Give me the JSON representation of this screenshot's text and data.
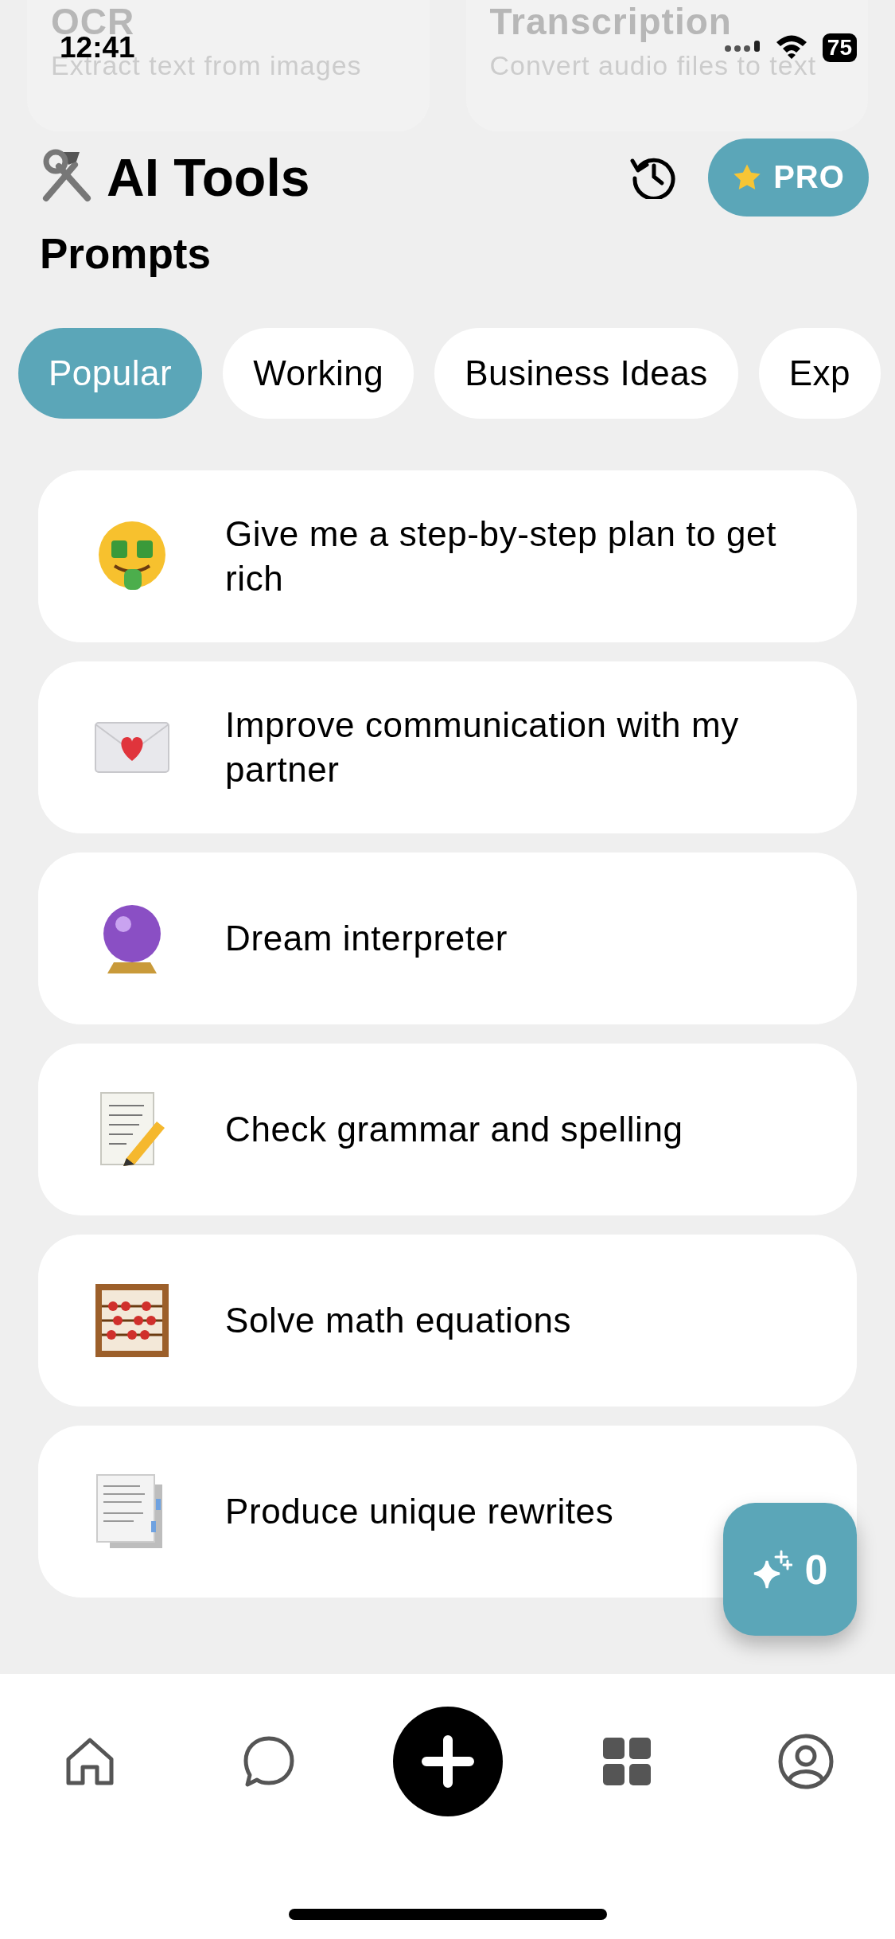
{
  "status_bar": {
    "time": "12:41",
    "battery": "75"
  },
  "background_cards": [
    {
      "title": "OCR",
      "subtitle": "Extract text from images"
    },
    {
      "title": "Transcription",
      "subtitle": "Convert audio files to text"
    }
  ],
  "header": {
    "title": "AI Tools",
    "pro_button": "PRO"
  },
  "section_title": "Prompts",
  "categories": [
    {
      "label": "Popular",
      "selected": true
    },
    {
      "label": "Working",
      "selected": false
    },
    {
      "label": "Business Ideas",
      "selected": false
    },
    {
      "label": "Exp",
      "selected": false
    }
  ],
  "prompts": [
    {
      "kind": "money",
      "text": "Give me a step-by-step plan to get rich"
    },
    {
      "kind": "letter",
      "text": "Improve communication with my partner"
    },
    {
      "kind": "crystal",
      "text": "Dream interpreter"
    },
    {
      "kind": "memo",
      "text": "Check grammar and spelling"
    },
    {
      "kind": "abacus",
      "text": "Solve math equations"
    },
    {
      "kind": "documents",
      "text": "Produce unique rewrites"
    }
  ],
  "credits_button": {
    "count": "0"
  },
  "tab_bar": [
    {
      "kind": "home"
    },
    {
      "kind": "chat"
    },
    {
      "kind": "add"
    },
    {
      "kind": "apps"
    },
    {
      "kind": "profile"
    }
  ]
}
